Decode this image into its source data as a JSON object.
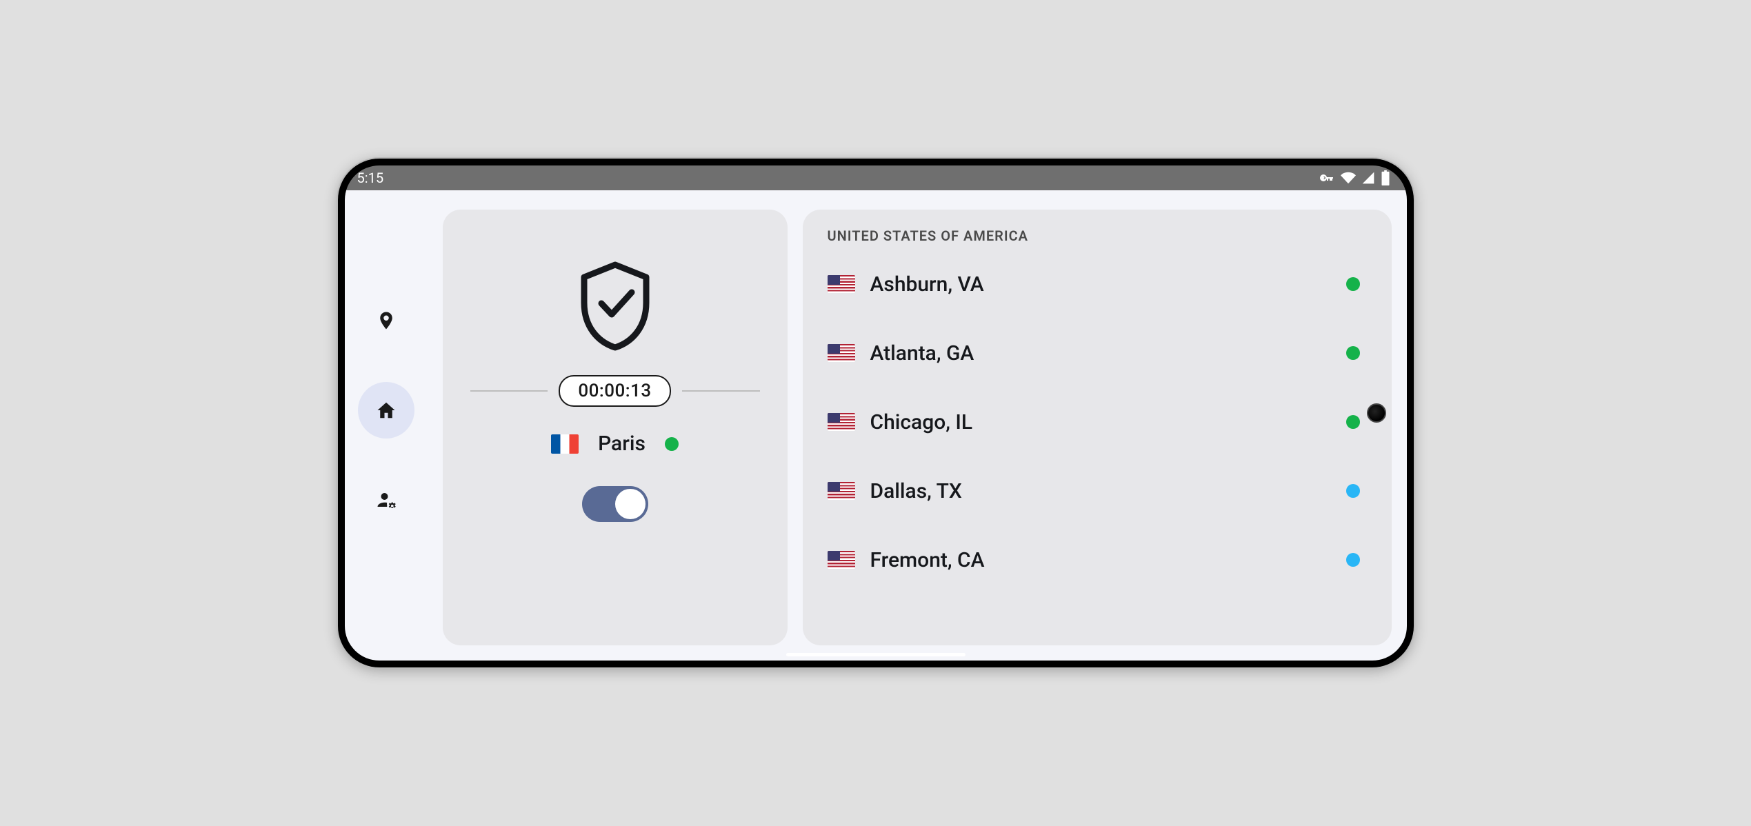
{
  "statusbar": {
    "time": "5:15"
  },
  "nav": {
    "items": [
      {
        "id": "location",
        "active": false
      },
      {
        "id": "home",
        "active": true
      },
      {
        "id": "account",
        "active": false
      }
    ]
  },
  "connection": {
    "timer": "00:00:13",
    "location_name": "Paris",
    "location_flag": "fr",
    "status_color": "green",
    "toggle_on": true
  },
  "server_section": {
    "header": "UNITED STATES OF AMERICA",
    "servers": [
      {
        "name": "Ashburn, VA",
        "flag": "us",
        "status": "green"
      },
      {
        "name": "Atlanta, GA",
        "flag": "us",
        "status": "green"
      },
      {
        "name": "Chicago, IL",
        "flag": "us",
        "status": "green"
      },
      {
        "name": "Dallas, TX",
        "flag": "us",
        "status": "blue"
      },
      {
        "name": "Fremont, CA",
        "flag": "us",
        "status": "blue"
      }
    ]
  }
}
